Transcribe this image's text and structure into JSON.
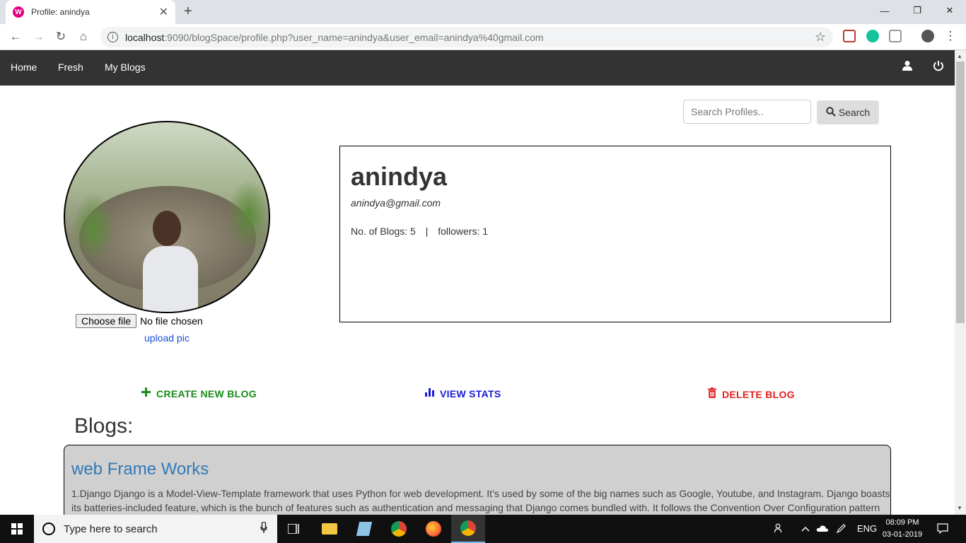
{
  "browser": {
    "tab_title": "Profile: anindya",
    "tab_favicon_letter": "W",
    "url_host": "localhost",
    "url_rest": ":9090/blogSpace/profile.php?user_name=anindya&user_email=anindya%40gmail.com"
  },
  "navbar": {
    "items": [
      "Home",
      "Fresh",
      "My Blogs"
    ]
  },
  "search": {
    "placeholder": "Search Profiles..",
    "button_label": "Search"
  },
  "avatar": {
    "file_button": "Choose file",
    "file_status": "No file chosen",
    "upload_link": "upload pic"
  },
  "profile": {
    "name": "anindya",
    "email": "anindya@gmail.com",
    "blogs_label": "No. of Blogs: 5",
    "separator": "|",
    "followers_label": "followers: 1"
  },
  "actions": {
    "create": "CREATE NEW BLOG",
    "stats": "VIEW STATS",
    "delete": "DELETE BLOG"
  },
  "blogs": {
    "heading": "Blogs:",
    "items": [
      {
        "title": "web Frame Works",
        "body": "1.Django Django is a Model-View-Template framework that uses Python for web development. It’s used by some of the big names such as Google, Youtube, and Instagram. Django boasts its batteries-included feature, which is the bunch of features such as authentication and messaging that Django comes bundled with. It follows the Convention Over Configuration pattern"
      }
    ]
  },
  "taskbar": {
    "search_placeholder": "Type here to search",
    "lang": "ENG",
    "time": "08:09 PM",
    "date": "03-01-2019"
  },
  "colors": {
    "navbar_bg": "#333333",
    "create_green": "#1a8a1a",
    "stats_blue": "#1a1ad4",
    "delete_red": "#e02020",
    "blog_title_blue": "#337ab7",
    "blog_card_bg": "#d0d0d0"
  }
}
